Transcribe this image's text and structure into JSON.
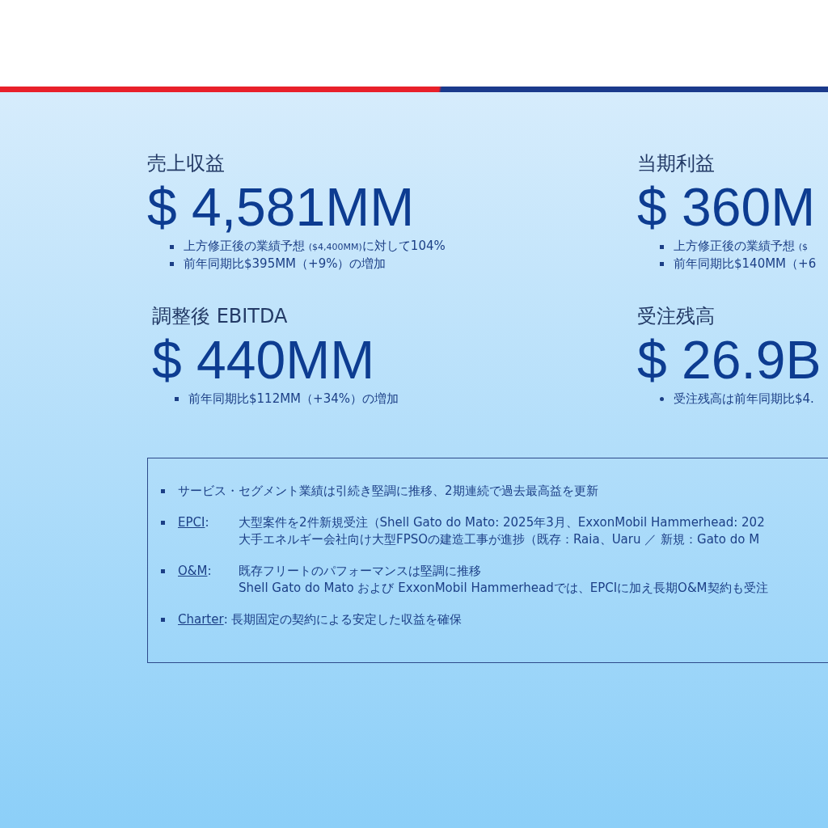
{
  "metrics": [
    {
      "label": "売上収益",
      "value": "$ 4,581MM",
      "bullets": [
        {
          "kind": "square",
          "text": "上方修正後の業績予想 $_{($4,400MM)}$に対して104%"
        },
        {
          "kind": "square",
          "text": "前年同期比$395MM（+9%）の増加"
        }
      ]
    },
    {
      "label": "当期利益",
      "value": "$ 360M",
      "bullets": [
        {
          "kind": "square",
          "text": "上方修正後の業績予想 $_{($}$"
        },
        {
          "kind": "square",
          "text": "前年同期比$140MM（+6"
        }
      ]
    },
    {
      "label": "調整後 EBITDA",
      "value": "$ 440MM",
      "bullets": [
        {
          "kind": "square",
          "text": "前年同期比$112MM（+34%）の増加"
        }
      ]
    },
    {
      "label": "受注残高",
      "value": "$ 26.9B",
      "bullets": [
        {
          "kind": "dot",
          "text": "受注残高は前年同期比$4."
        }
      ]
    }
  ],
  "highlights": [
    {
      "kind": "plain",
      "lines": [
        "サービス・セグメント業績は引続き堅調に推移、2期連続で過去最高益を更新"
      ]
    },
    {
      "kind": "tabbed",
      "label": "EPCI",
      "separator": ":",
      "lines": [
        "大型案件を2件新規受注（Shell Gato do Mato: 2025年3月、ExxonMobil Hammerhead: 202",
        "大手エネルギー会社向け大型FPSOの建造工事が進捗（既存：Raia、Uaru ／ 新規：Gato do M"
      ]
    },
    {
      "kind": "tabbed",
      "label": "O&M",
      "separator": ":",
      "lines": [
        "既存フリートのパフォーマンスは堅調に推移",
        "Shell Gato do Mato および ExxonMobil Hammerheadでは、EPCIに加え長期O&M契約も受注"
      ]
    },
    {
      "kind": "inline",
      "label": "Charter",
      "separator": ":",
      "lines": [
        "長期固定の契約による安定した収益を確保"
      ]
    }
  ]
}
